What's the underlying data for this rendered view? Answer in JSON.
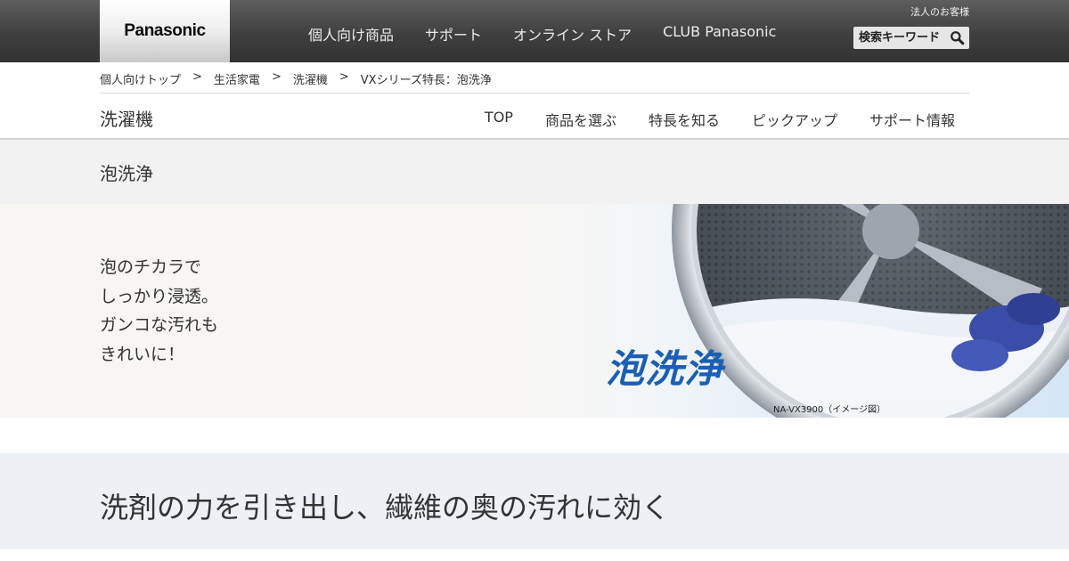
{
  "brand": {
    "logo_text": "Panasonic"
  },
  "global_nav": {
    "items": [
      "個人向け商品",
      "サポート",
      "オンライン ストア",
      "CLUB Panasonic"
    ],
    "corporate_link": "法人のお客様",
    "search": {
      "placeholder": "検索キーワード",
      "icon": "search-icon"
    }
  },
  "breadcrumb": {
    "items": [
      "個人向けトップ",
      "生活家電",
      "洗濯機",
      "VXシリーズ特長：泡洗浄"
    ],
    "separator": ">"
  },
  "category": {
    "title": "洗濯機",
    "nav": [
      "TOP",
      "商品を選ぶ",
      "特長を知る",
      "ピックアップ",
      "サポート情報"
    ]
  },
  "page": {
    "title": "泡洗浄"
  },
  "hero": {
    "copy": [
      "泡のチカラで",
      "しっかり浸透。",
      "ガンコな汚れも",
      "きれいに！"
    ],
    "logo_text": "泡洗浄",
    "caption": "NA-VX3900（イメージ図）",
    "accent_color": "#1a5fb5"
  },
  "section": {
    "heading": "洗剤の力を引き出し、繊維の奥の汚れに効く"
  }
}
